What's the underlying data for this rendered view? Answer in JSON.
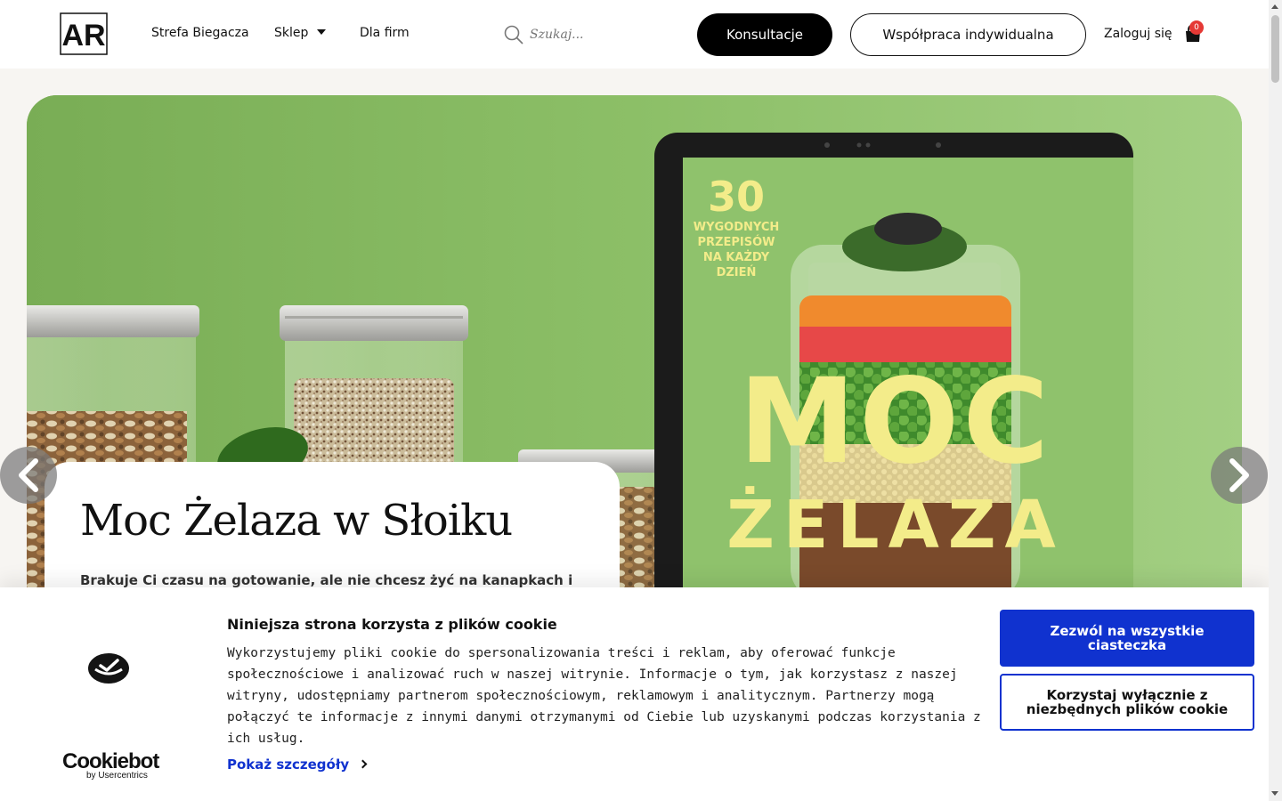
{
  "header": {
    "logo_text": "AR",
    "nav": [
      {
        "label": "Strefa Biegacza"
      },
      {
        "label": "Sklep"
      },
      {
        "label": "Dla firm"
      }
    ],
    "search_placeholder": "Szukaj...",
    "consult_button": "Konsultacje",
    "coop_button": "Współpraca indywidualna",
    "login": "Zaloguj się",
    "cart_count": "0"
  },
  "hero": {
    "cover_number": "30",
    "cover_subtitle": [
      "WYGODNYCH",
      "PRZEPISÓW",
      "NA KAŻDY",
      "DZIEŃ"
    ],
    "cover_title": [
      "MOC",
      "ŻELAZA"
    ],
    "title": "Moc Żelaza w Słoiku",
    "text": "Brakuje Ci czasu na gotowanie, ale nie chcesz żyć na kanapkach i"
  },
  "cookie": {
    "title": "Niniejsza strona korzysta z plików cookie",
    "text": "Wykorzystujemy pliki cookie do spersonalizowania treści i reklam, aby oferować funkcje społecznościowe i analizować ruch w naszej witrynie. Informacje o tym, jak korzystasz z naszej witryny, udostępniamy partnerom społecznościowym, reklamowym i analitycznym. Partnerzy mogą połączyć te informacje z innymi danymi otrzymanymi od Ciebie lub uzyskanymi podczas korzystania z ich usług.",
    "details": "Pokaż szczegóły",
    "allow_all": "Zezwól na wszystkie ciasteczka",
    "necessary_only": "Korzystaj wyłącznie z niezbędnych plików cookie",
    "brand": "Cookiebot",
    "brand_by": "by Usercentrics"
  },
  "colors": {
    "hero_green": "#86b862",
    "cover_yellow": "#f3ec8a",
    "cookie_blue": "#1032cf",
    "badge_red": "#e53935"
  }
}
